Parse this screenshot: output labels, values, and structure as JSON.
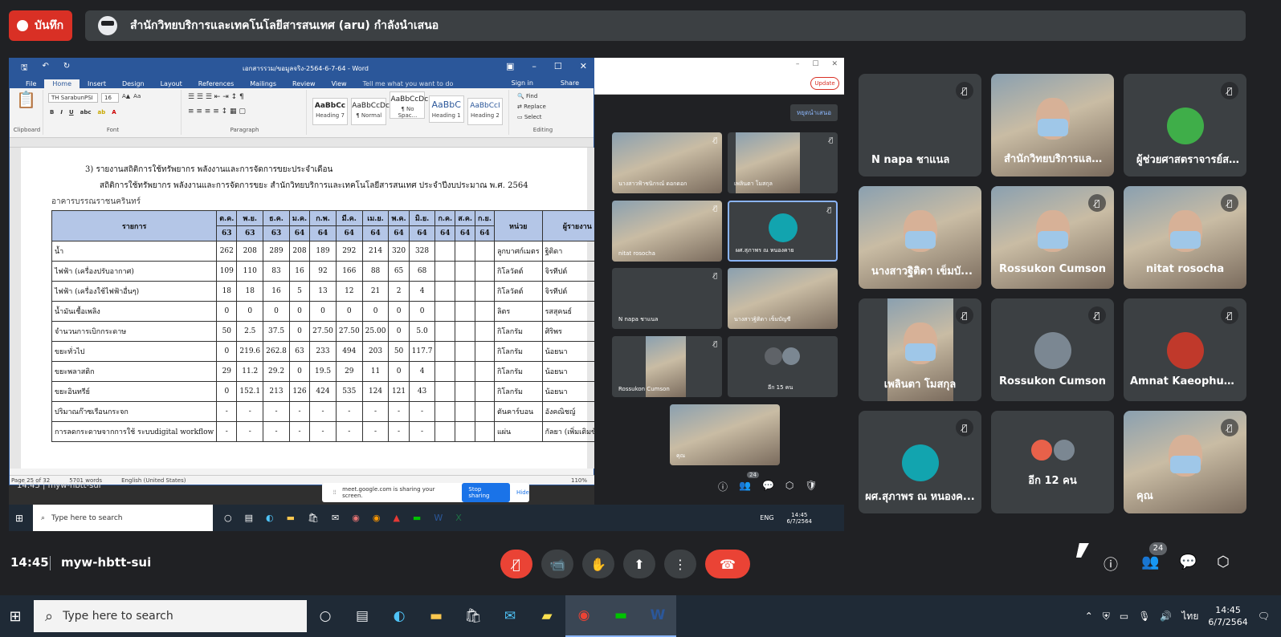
{
  "record": {
    "label": "บันทึก"
  },
  "presenting": {
    "text": "สำนักวิทยบริการและเทคโนโลยีสารสนเทศ (aru) กำลังนำเสนอ"
  },
  "word": {
    "title": "เอกสารรวม/ขอมูลจริง-2564-6-7-64 - Word",
    "tabs": [
      "File",
      "Home",
      "Insert",
      "Design",
      "Layout",
      "References",
      "Mailings",
      "Review",
      "View"
    ],
    "tell_me": "Tell me what you want to do",
    "sign_in": "Sign in",
    "share": "Share",
    "font": "TH SarabunPSI",
    "font_size": "16",
    "groups": {
      "clipboard": "Clipboard",
      "font": "Font",
      "paragraph": "Paragraph",
      "styles": "Styles",
      "editing": "Editing"
    },
    "styles": [
      {
        "sample": "AaBbCc",
        "name": "Heading 7"
      },
      {
        "sample": "AaBbCcDc",
        "name": "¶ Normal"
      },
      {
        "sample": "AaBbCcDc",
        "name": "¶ No Spac..."
      },
      {
        "sample": "AaBbC",
        "name": "Heading 1"
      },
      {
        "sample": "AaBbCcI",
        "name": "Heading 2"
      }
    ],
    "editing": {
      "find": "Find",
      "replace": "Replace",
      "select": "Select"
    },
    "status": {
      "page": "Page 25 of 32",
      "words": "5701 words",
      "lang": "English (United States)",
      "zoom": "110%"
    },
    "doc": {
      "heading": "3) รายงานสถิติการใช้ทรัพยากร พลังงานและการจัดการขยะประจำเดือน",
      "subheading": "สถิติการใช้ทรัพยากร พลังงานและการจัดการขยะ สำนักวิทยบริการและเทคโนโลยีสารสนเทศ ประจำปีงบประมาณ พ.ศ. 2564",
      "building": "อาคารบรรณราชนครินทร์",
      "headers": [
        "รายการ",
        "ต.ค.",
        "พ.ย.",
        "ธ.ค.",
        "ม.ค.",
        "ก.พ.",
        "มี.ค.",
        "เม.ย.",
        "พ.ค.",
        "มิ.ย.",
        "ก.ค.",
        "ส.ค.",
        "ก.ย.",
        "หน่วย",
        "ผู้รายงาน"
      ],
      "years": [
        "63",
        "63",
        "63",
        "64",
        "64",
        "64",
        "64",
        "64",
        "64",
        "64",
        "64",
        "64"
      ],
      "rows": [
        {
          "item": "น้ำ",
          "values": [
            "262",
            "208",
            "289",
            "208",
            "189",
            "292",
            "214",
            "320",
            "328",
            "",
            "",
            ""
          ],
          "unit": "ลูกบาศก์เมตร",
          "reporter": "ฐิติดา"
        },
        {
          "item": "ไฟฟ้า (เครื่องปรับอากาศ)",
          "values": [
            "109",
            "110",
            "83",
            "16",
            "92",
            "166",
            "88",
            "65",
            "68",
            "",
            "",
            ""
          ],
          "unit": "กิโลวัตต์",
          "reporter": "จิรทีปต์"
        },
        {
          "item": "ไฟฟ้า (เครื่องใช้ไฟฟ้าอื่นๆ)",
          "values": [
            "18",
            "18",
            "16",
            "5",
            "13",
            "12",
            "21",
            "2",
            "4",
            "",
            "",
            ""
          ],
          "unit": "กิโลวัตต์",
          "reporter": "จิรทีปต์"
        },
        {
          "item": "น้ำมันเชื้อเพลิง",
          "values": [
            "0",
            "0",
            "0",
            "0",
            "0",
            "0",
            "0",
            "0",
            "0",
            "",
            "",
            ""
          ],
          "unit": "ลิตร",
          "reporter": "รสสุคนธ์"
        },
        {
          "item": "จำนวนการเบิกกระดาษ",
          "values": [
            "50",
            "2.5",
            "37.5",
            "0",
            "27.50",
            "27.50",
            "25.00",
            "0",
            "5.0",
            "",
            "",
            ""
          ],
          "unit": "กิโลกรัม",
          "reporter": "ศิริพร"
        },
        {
          "item": "ขยะทั่วไป",
          "values": [
            "0",
            "219.6",
            "262.8",
            "63",
            "233",
            "494",
            "203",
            "50",
            "117.7",
            "",
            "",
            ""
          ],
          "unit": "กิโลกรัม",
          "reporter": "น้อยนา"
        },
        {
          "item": "ขยะพลาสติก",
          "values": [
            "29",
            "11.2",
            "29.2",
            "0",
            "19.5",
            "29",
            "11",
            "0",
            "4",
            "",
            "",
            ""
          ],
          "unit": "กิโลกรัม",
          "reporter": "น้อยนา"
        },
        {
          "item": "ขยะอินทรีย์",
          "values": [
            "0",
            "152.1",
            "213",
            "126",
            "424",
            "535",
            "124",
            "121",
            "43",
            "",
            "",
            ""
          ],
          "unit": "กิโลกรัม",
          "reporter": "น้อยนา"
        },
        {
          "item": "ปริมาณก๊าซเรือนกระจก",
          "values": [
            "-",
            "-",
            "-",
            "-",
            "-",
            "-",
            "-",
            "-",
            "-",
            "",
            "",
            ""
          ],
          "unit": "ตันคาร์บอน",
          "reporter": "อังคณิชญ์"
        },
        {
          "item": "การลดกระดาษจากการใช้ ระบบdigital workflow",
          "values": [
            "-",
            "-",
            "-",
            "-",
            "-",
            "-",
            "-",
            "-",
            "-",
            "",
            "",
            ""
          ],
          "unit": "แผ่น",
          "reporter": "กัลยา (เพิ่มเติมข้อมูล"
        }
      ]
    }
  },
  "chrome": {
    "update": "Update"
  },
  "inner_meet": {
    "stop_present": "หยุดนำเสนอ",
    "tiles": [
      {
        "name": "นางสาวฟ้าชนิกรณ์ ดอกดอก"
      },
      {
        "name": "เพลินตา โมสกุล"
      },
      {
        "name": "nitat rosocha"
      },
      {
        "name": "ผศ.สุภาพร ณ หนองคาย"
      },
      {
        "name": "N napa ชาแนล"
      },
      {
        "name": "นางสาวฐิติดา เข็มบัญชี"
      },
      {
        "name": "Rossukon Cumson"
      },
      {
        "name": "อีก 15 คน"
      },
      {
        "name": "คุณ"
      }
    ],
    "badge": "24"
  },
  "share_bar": {
    "text": "meet.google.com is sharing your screen.",
    "stop": "Stop sharing",
    "hide": "Hide"
  },
  "inner_taskbar": {
    "search": "Type here to search",
    "lang": "ENG",
    "time": "14:45",
    "date": "6/7/2564",
    "meeting_clock": "14:45",
    "meeting_code": "myw-hbtt-sui"
  },
  "participants": [
    {
      "name": "N napa ชาแนล"
    },
    {
      "name": "สำนักวิทยบริการและ..."
    },
    {
      "name": "ผู้ช่วยศาสตราจารย์ส..."
    },
    {
      "name": "นางสาวฐิติดา เข็มบั..."
    },
    {
      "name": "Rossukon Cumson"
    },
    {
      "name": "nitat rosocha"
    },
    {
      "name": "เพลินตา โมสกุล"
    },
    {
      "name": "Rossukon Cumson"
    },
    {
      "name": "Amnat Kaeophupha"
    },
    {
      "name": "ผศ.สุภาพร ณ หนองค..."
    },
    {
      "name": "อีก 12 คน"
    },
    {
      "name": "คุณ"
    }
  ],
  "meeting": {
    "clock": "14:45",
    "code": "myw-hbtt-sui",
    "participant_count": "24"
  },
  "taskbar": {
    "search": "Type here to search",
    "lang": "ไทย",
    "time": "14:45",
    "date": "6/7/2564"
  }
}
